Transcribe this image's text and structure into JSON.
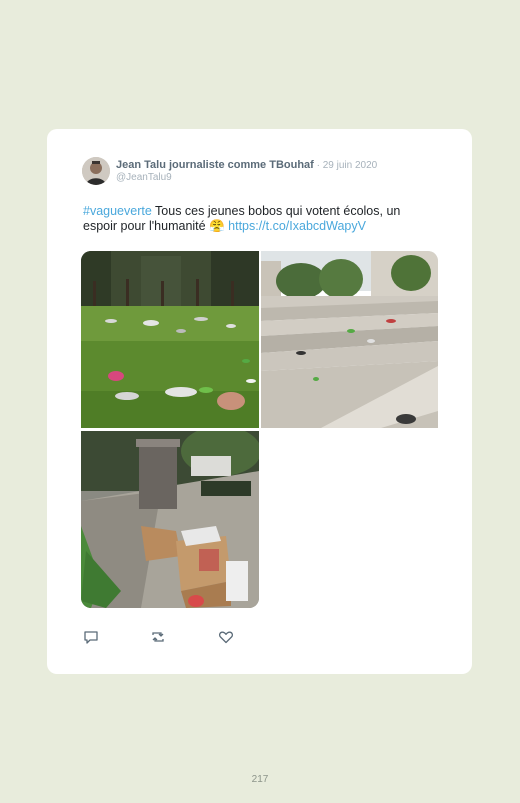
{
  "tweet": {
    "author_name": "Jean Talu journaliste comme TBouhaf",
    "date": "29 juin 2020",
    "date_separator": " · ",
    "handle": "@JeanTalu9",
    "hashtag": "#vagueverte",
    "text": " Tous ces jeunes bobos qui votent écolos, un espoir pour l'humanité ",
    "emoji": "😤",
    "link": "https://t.co/IxabcdWapyV",
    "photos": [
      "park-lawn-litter-photo",
      "stone-steps-litter-photo",
      "overflowing-bin-photo"
    ]
  },
  "actions": {
    "icons": [
      "reply-icon",
      "retweet-icon",
      "like-icon"
    ]
  },
  "page": {
    "number": "217"
  },
  "colors": {
    "page_background": "#e8ecdc",
    "card_background": "#ffffff",
    "link": "#4aa8dc",
    "author": "#5b6b78",
    "muted": "#a7b2bb"
  }
}
